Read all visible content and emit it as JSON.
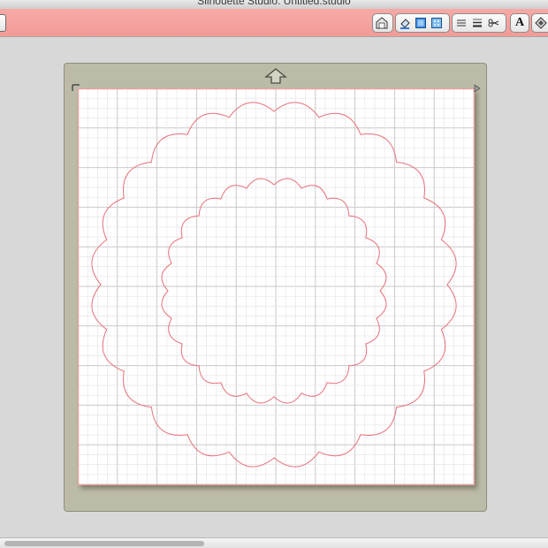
{
  "window": {
    "title": "Silhouette Studio: Untitled.studio"
  },
  "toolbar": {
    "groups": [
      {
        "name": "library-group",
        "items": [
          "library-icon"
        ]
      },
      {
        "name": "fill-group",
        "items": [
          "fill-icon",
          "line-color-icon",
          "pattern-fill-icon"
        ]
      },
      {
        "name": "line-group",
        "items": [
          "line-style-icon",
          "line-thickness-icon",
          "cut-style-icon"
        ]
      },
      {
        "name": "text-group",
        "items": [
          "text-style-icon"
        ]
      },
      {
        "name": "transform-group",
        "items": [
          "transform-icon"
        ]
      }
    ],
    "text_style_label": "A",
    "accent": "#f29b97"
  },
  "mat": {
    "color": "#bcbba8",
    "grid": "on",
    "load_arrow": "up-arrow-icon"
  },
  "design": {
    "shapes": [
      {
        "name": "outer-scallop-circle",
        "scallops": 24
      },
      {
        "name": "inner-scallop-circle",
        "scallops": 24
      }
    ],
    "cut_line_color": "#e8707a"
  }
}
